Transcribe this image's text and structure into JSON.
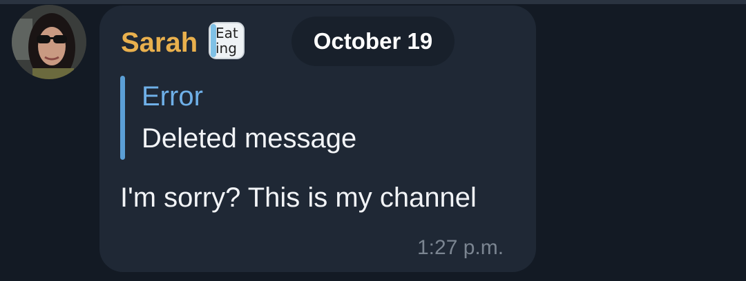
{
  "message": {
    "sender_name": "Sarah",
    "sticker_text": "Eat ing",
    "date_label": "October 19",
    "reply": {
      "author": "Error",
      "text": "Deleted message"
    },
    "text": "I'm sorry? This is my channel",
    "time": "1:27 p.m."
  },
  "colors": {
    "background": "#131a24",
    "bubble": "#1f2835",
    "sender_name": "#e9b04d",
    "reply_accent": "#5b9fd6",
    "reply_author": "#6fb0e8",
    "time": "#7b8591"
  }
}
